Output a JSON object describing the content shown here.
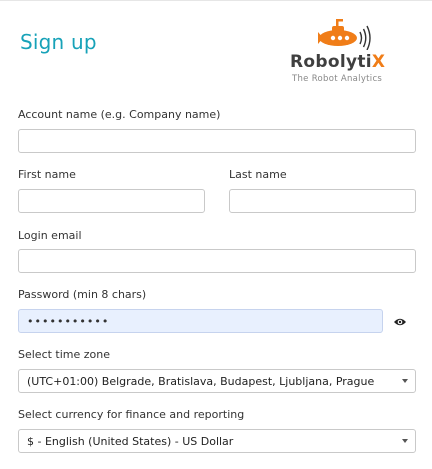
{
  "header": {
    "title": "Sign up",
    "logo_wordmark_main": "Robolyti",
    "logo_wordmark_x": "X",
    "logo_tagline": "The Robot Analytics",
    "accent_color": "#17a2b8",
    "brand_color": "#f07d18"
  },
  "form": {
    "account_name_label": "Account name (e.g. Company name)",
    "account_name_value": "",
    "first_name_label": "First name",
    "first_name_value": "",
    "last_name_label": "Last name",
    "last_name_value": "",
    "login_email_label": "Login email",
    "login_email_value": "",
    "password_label": "Password (min 8 chars)",
    "password_value": "•••••••••••",
    "password_toggle_icon": "eye-icon",
    "timezone_label": "Select time zone",
    "timezone_value": "(UTC+01:00) Belgrade, Bratislava, Budapest, Ljubljana, Prague",
    "currency_label": "Select currency for finance and reporting",
    "currency_value": "$ - English (United States) - US Dollar"
  }
}
